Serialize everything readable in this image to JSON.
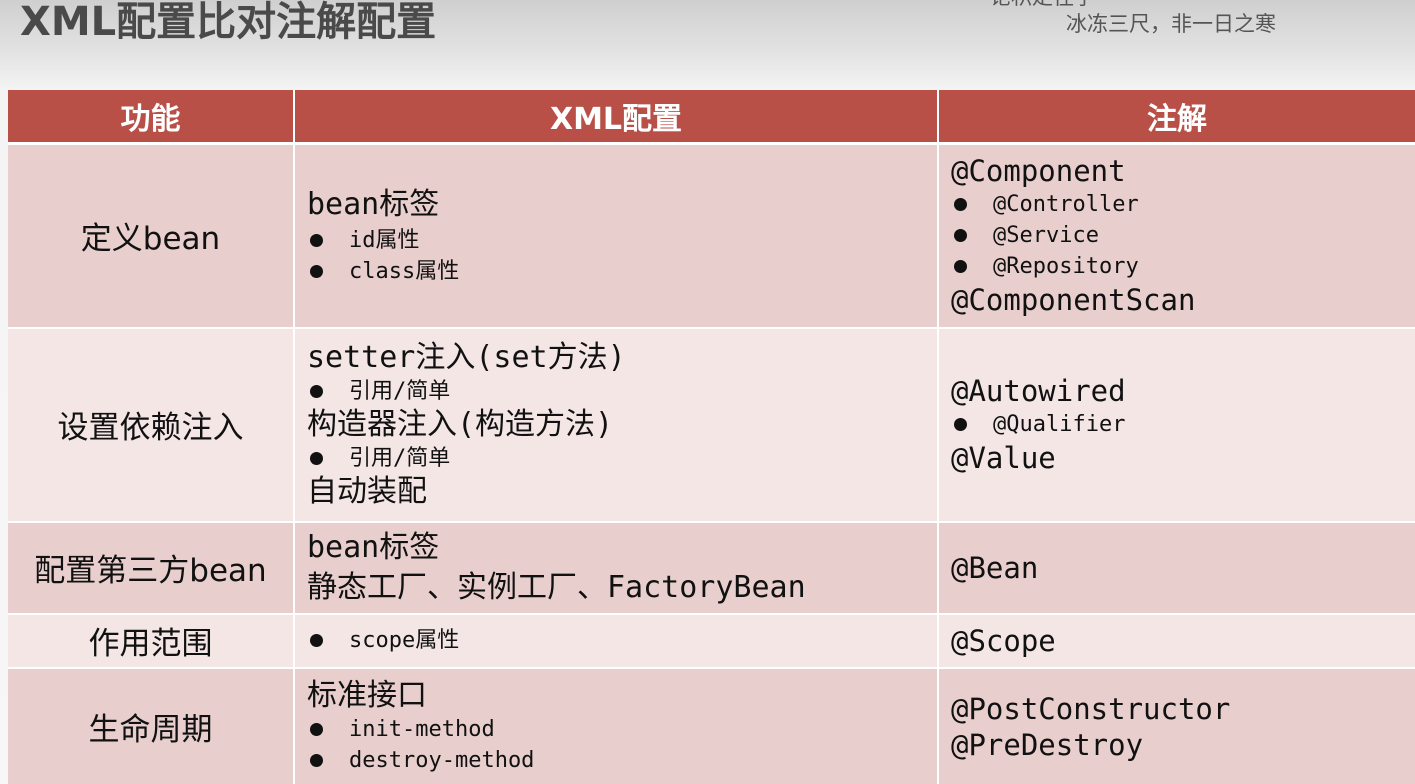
{
  "slide": {
    "title": "XML配置比对注解配置",
    "motto_line1": "论积走径学",
    "motto_line2": "冰冻三尺，非一日之寒"
  },
  "table": {
    "headers": [
      "功能",
      "XML配置",
      "注解"
    ],
    "rows": [
      {
        "function": "定义bean",
        "xml_main": "bean标签",
        "xml_bullets": [
          "id属性",
          "class属性"
        ],
        "ann_top": "@Component",
        "ann_bullets": [
          "@Controller",
          "@Service",
          "@Repository"
        ],
        "ann_bottom": "@ComponentScan"
      },
      {
        "function": "设置依赖注入",
        "xml_line1": "setter注入(set方法)",
        "xml_bullet1": "引用/简单",
        "xml_line2": "构造器注入(构造方法)",
        "xml_bullet2": "引用/简单",
        "xml_line3": "自动装配",
        "ann_top": "@Autowired",
        "ann_bullets": [
          "@Qualifier"
        ],
        "ann_bottom": "@Value"
      },
      {
        "function": "配置第三方bean",
        "xml_line1": "bean标签",
        "xml_line2": "静态工厂、实例工厂、FactoryBean",
        "ann": "@Bean"
      },
      {
        "function": "作用范围",
        "xml_bullets": [
          "scope属性"
        ],
        "ann": "@Scope"
      },
      {
        "function": "生命周期",
        "xml_main": "标准接口",
        "xml_bullets": [
          "init-method",
          "destroy-method"
        ],
        "ann_line1": "@PostConstructor",
        "ann_line2": "@PreDestroy"
      }
    ]
  }
}
